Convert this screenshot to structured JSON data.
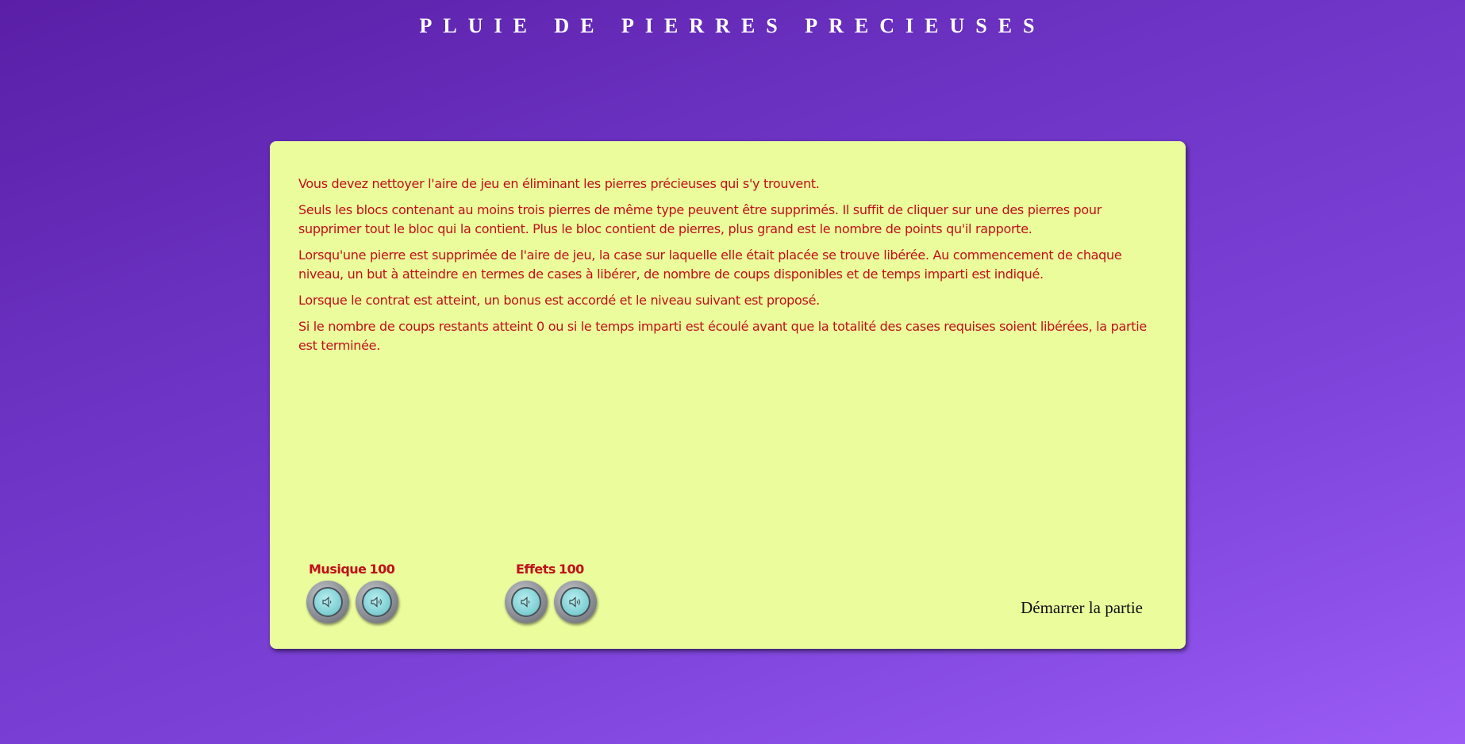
{
  "title": "PLUIE DE PIERRES PRECIEUSES",
  "rules": [
    "Vous devez nettoyer l'aire de jeu en éliminant les pierres précieuses qui s'y trouvent.",
    "Seuls les blocs contenant au moins trois pierres de même type peuvent être supprimés. Il suffit de cliquer sur une des pierres pour supprimer tout le bloc qui la contient. Plus le bloc contient de pierres, plus grand est le nombre de points qu'il rapporte.",
    "Lorsqu'une pierre est supprimée de l'aire de jeu, la case sur laquelle elle était placée se trouve libérée. Au commencement de chaque niveau, un but à atteindre en termes de cases à libérer, de nombre de coups disponibles et de temps imparti est indiqué.",
    "Lorsque le contrat est atteint, un bonus est accordé et le niveau suivant est proposé.",
    "Si le nombre de coups restants atteint 0 ou si le temps imparti est écoulé avant que la totalité des cases requises soient libérées, la partie est terminée."
  ],
  "music": {
    "label": "Musique",
    "value": "100",
    "decrease_icon": "speaker-low-icon",
    "increase_icon": "speaker-high-icon"
  },
  "effects": {
    "label": "Effets",
    "value": "100",
    "decrease_icon": "speaker-low-icon",
    "increase_icon": "speaker-high-icon"
  },
  "start_label": "Démarrer la partie",
  "colors": {
    "background": "#7a3fd6",
    "panel": "#eafc9c",
    "text": "#c0101a"
  }
}
